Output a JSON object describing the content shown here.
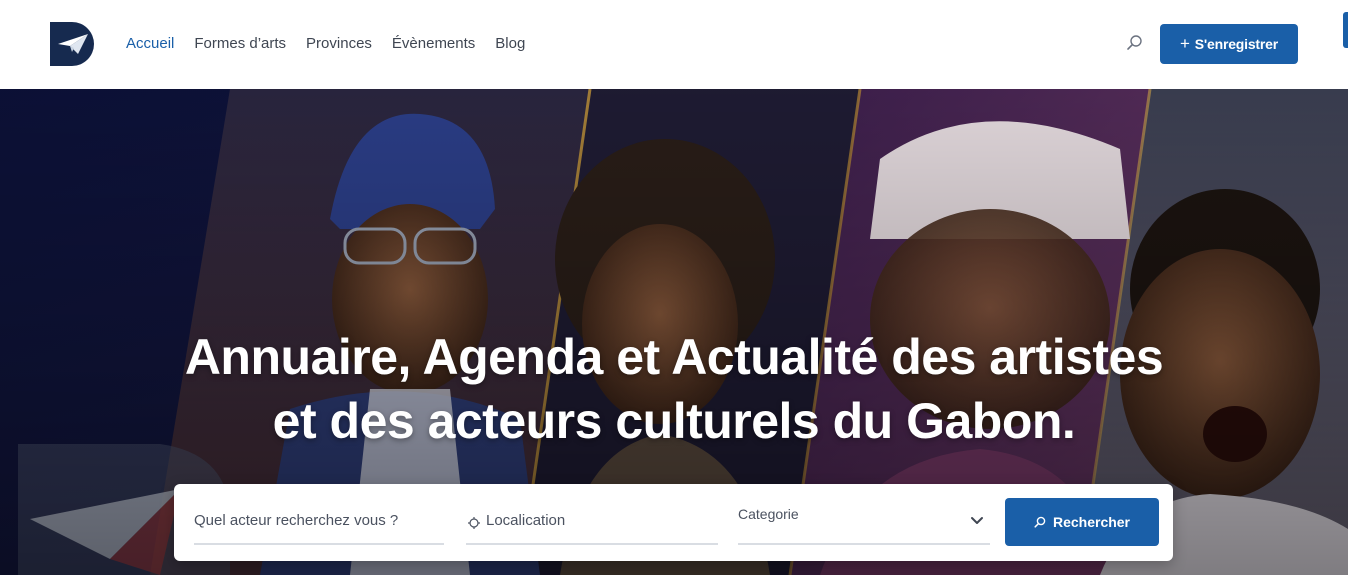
{
  "header": {
    "logo_icon": "plane-d-logo-icon",
    "nav": [
      {
        "label": "Accueil",
        "active": true
      },
      {
        "label": "Formes d’arts",
        "active": false
      },
      {
        "label": "Provinces",
        "active": false
      },
      {
        "label": "Évènements",
        "active": false
      },
      {
        "label": "Blog",
        "active": false
      }
    ],
    "search_icon": "search-icon",
    "register_label": "S'enregistrer",
    "register_icon": "plus-icon"
  },
  "hero": {
    "title_line1": "Annuaire, Agenda et Actualité des artistes",
    "title_line2": "et des acteurs culturels du Gabon."
  },
  "search": {
    "actor_placeholder": "Quel acteur recherchez vous ?",
    "location_placeholder": "Localication",
    "location_icon": "location-icon",
    "category_value": "Categorie",
    "category_icon": "chevron-down-icon",
    "submit_label": "Rechercher",
    "submit_icon": "search-icon"
  },
  "colors": {
    "accent": "#1a5fa8",
    "hero_dark": "#0b1030",
    "nav_text": "#3f4652"
  }
}
